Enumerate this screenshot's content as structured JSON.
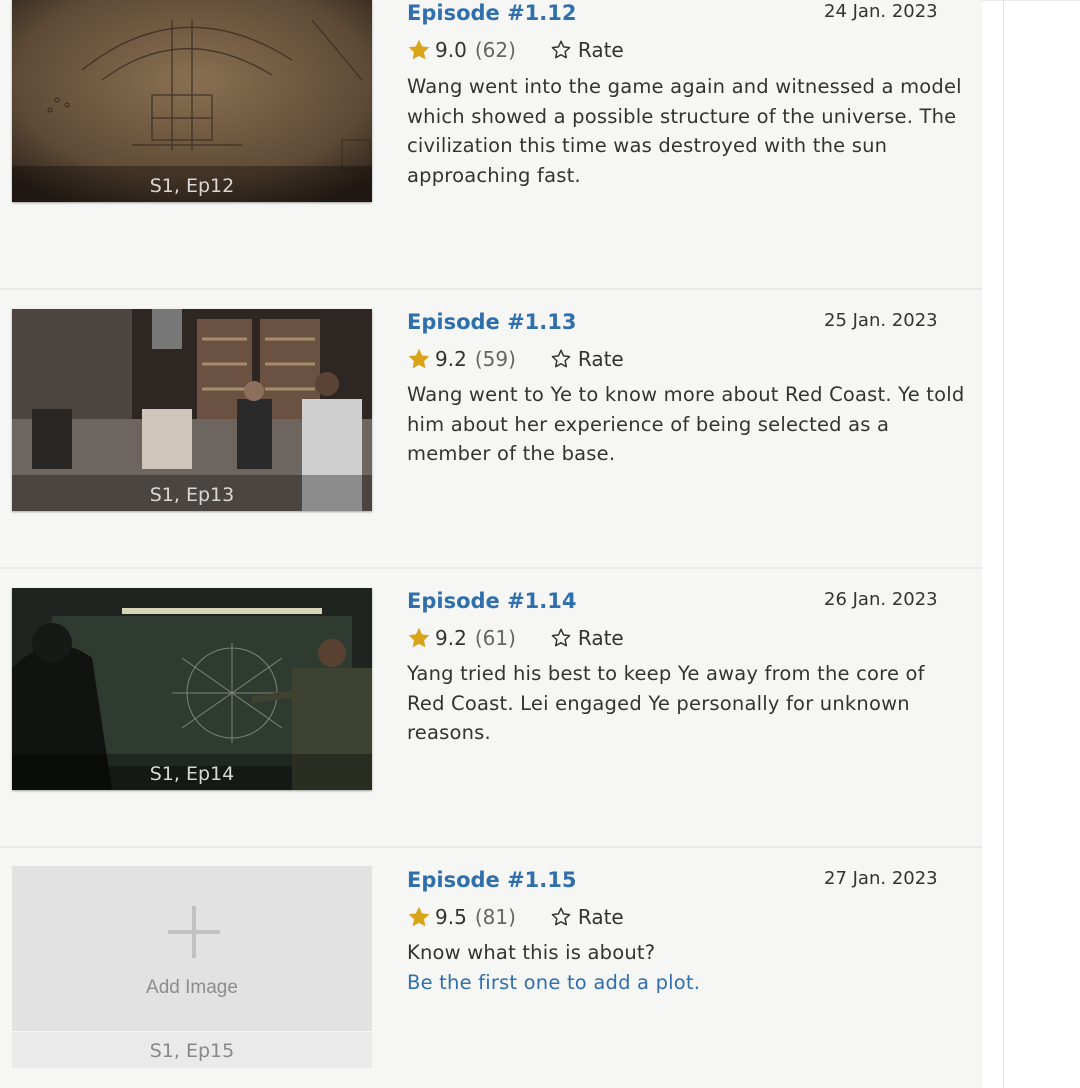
{
  "episodes": [
    {
      "title": "Episode #1.12",
      "date": "24 Jan. 2023",
      "rating": "9.0",
      "votes": "(62)",
      "rate_label": "Rate",
      "caption": "S1, Ep12",
      "plot": "Wang went into the game again and witnessed a model which showed a possible structure of the universe. The civilization this time was destroyed with the sun approaching fast."
    },
    {
      "title": "Episode #1.13",
      "date": "25 Jan. 2023",
      "rating": "9.2",
      "votes": "(59)",
      "rate_label": "Rate",
      "caption": "S1, Ep13",
      "plot": "Wang went to Ye to know more about Red Coast. Ye told him about her experience of being selected as a member of the base."
    },
    {
      "title": "Episode #1.14",
      "date": "26 Jan. 2023",
      "rating": "9.2",
      "votes": "(61)",
      "rate_label": "Rate",
      "caption": "S1, Ep14",
      "plot": "Yang tried his best to keep Ye away from the core of Red Coast. Lei engaged Ye personally for unknown reasons."
    },
    {
      "title": "Episode #1.15",
      "date": "27 Jan. 2023",
      "rating": "9.5",
      "votes": "(81)",
      "rate_label": "Rate",
      "caption": "S1, Ep15",
      "add_image_label": "Add Image",
      "plot_prompt": "Know what this is about?",
      "plot_link": "Be the first one to add a plot."
    }
  ],
  "colors": {
    "link": "#2f6fad",
    "star": "#f5c518",
    "row_alt": "#f6f6f5"
  }
}
